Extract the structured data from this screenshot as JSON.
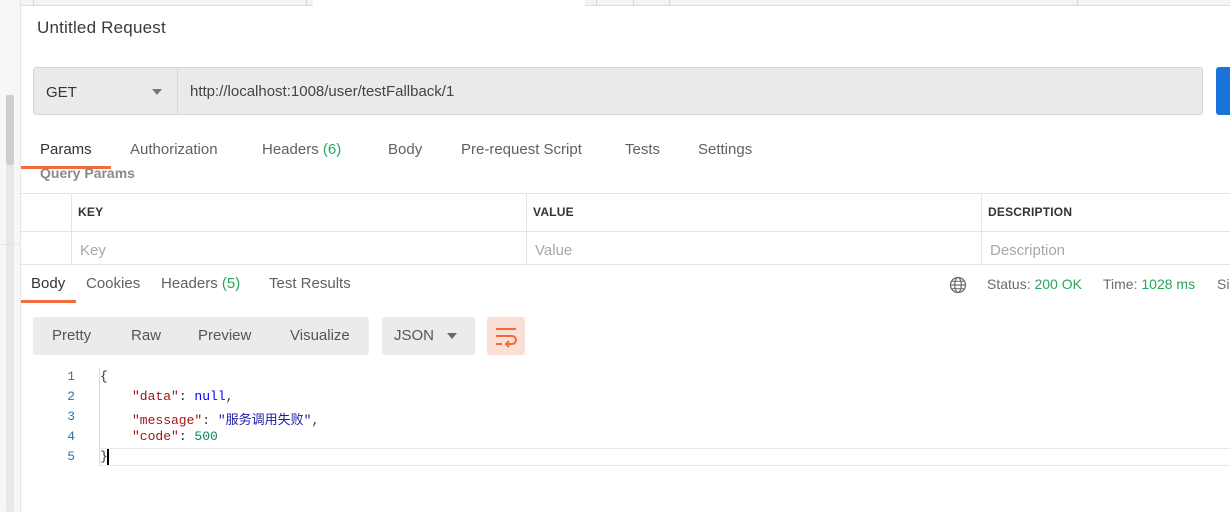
{
  "request": {
    "title": "Untitled Request",
    "method": "GET",
    "url": "http://localhost:1008/user/testFallback/1"
  },
  "request_tabs": {
    "params": "Params",
    "authorization": "Authorization",
    "headers": "Headers",
    "headers_count": "(6)",
    "body": "Body",
    "pre_request_script": "Pre-request Script",
    "tests": "Tests",
    "settings": "Settings"
  },
  "query_params": {
    "label": "Query Params",
    "columns": [
      "KEY",
      "VALUE",
      "DESCRIPTION"
    ],
    "placeholders": {
      "key": "Key",
      "value": "Value",
      "description": "Description"
    }
  },
  "response_tabs": {
    "body": "Body",
    "cookies": "Cookies",
    "headers": "Headers",
    "headers_count": "(5)",
    "test_results": "Test Results"
  },
  "response_meta": {
    "status_label": "Status:",
    "status_value": "200 OK",
    "time_label": "Time:",
    "time_value": "1028 ms",
    "size_label": "Si"
  },
  "format_toolbar": {
    "pretty": "Pretty",
    "raw": "Raw",
    "preview": "Preview",
    "visualize": "Visualize",
    "language": "JSON"
  },
  "response_body": {
    "line_numbers": [
      "1",
      "2",
      "3",
      "4",
      "5"
    ],
    "open_brace": "{",
    "close_brace": "}",
    "lines": [
      {
        "key": "\"data\"",
        "value": "null",
        "type": "keyword",
        "trail": ","
      },
      {
        "key": "\"message\"",
        "value": "\"服务调用失败\"",
        "type": "string",
        "trail": ","
      },
      {
        "key": "\"code\"",
        "value": "500",
        "type": "number",
        "trail": ""
      }
    ]
  },
  "colors": {
    "accent": "#f26b3a",
    "status_ok": "#26a65b",
    "send_button": "#1a73d9"
  },
  "icons": {
    "globe": "globe-icon",
    "wrap": "wrap-lines-icon",
    "caret": "chevron-down-icon"
  }
}
